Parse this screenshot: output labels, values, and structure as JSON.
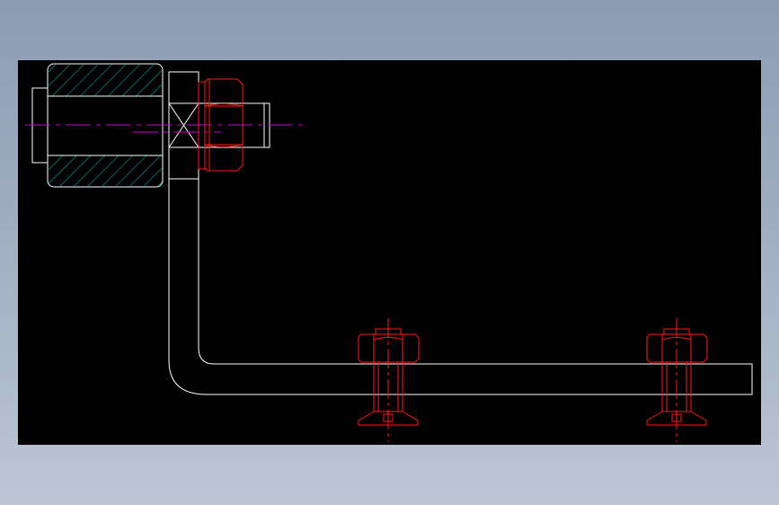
{
  "app": {
    "title": ""
  },
  "colors": {
    "background": "#000000",
    "frame_gradient_top": "#8c9cb2",
    "frame_gradient_bottom": "#bcc5d3",
    "outline": "#ffffff",
    "hatch": "#00c8c8",
    "fastener": "#ff1a1a",
    "centerline": "#c800c8"
  },
  "drawing": {
    "parts": [
      {
        "name": "roller-bushing",
        "style": "hatched-section"
      },
      {
        "name": "bracket-stud",
        "style": "outline"
      },
      {
        "name": "hex-nut",
        "style": "fastener"
      },
      {
        "name": "bent-bracket-arm",
        "style": "outline"
      },
      {
        "name": "countersunk-bolt-left",
        "style": "fastener"
      },
      {
        "name": "countersunk-bolt-right",
        "style": "fastener"
      }
    ]
  }
}
